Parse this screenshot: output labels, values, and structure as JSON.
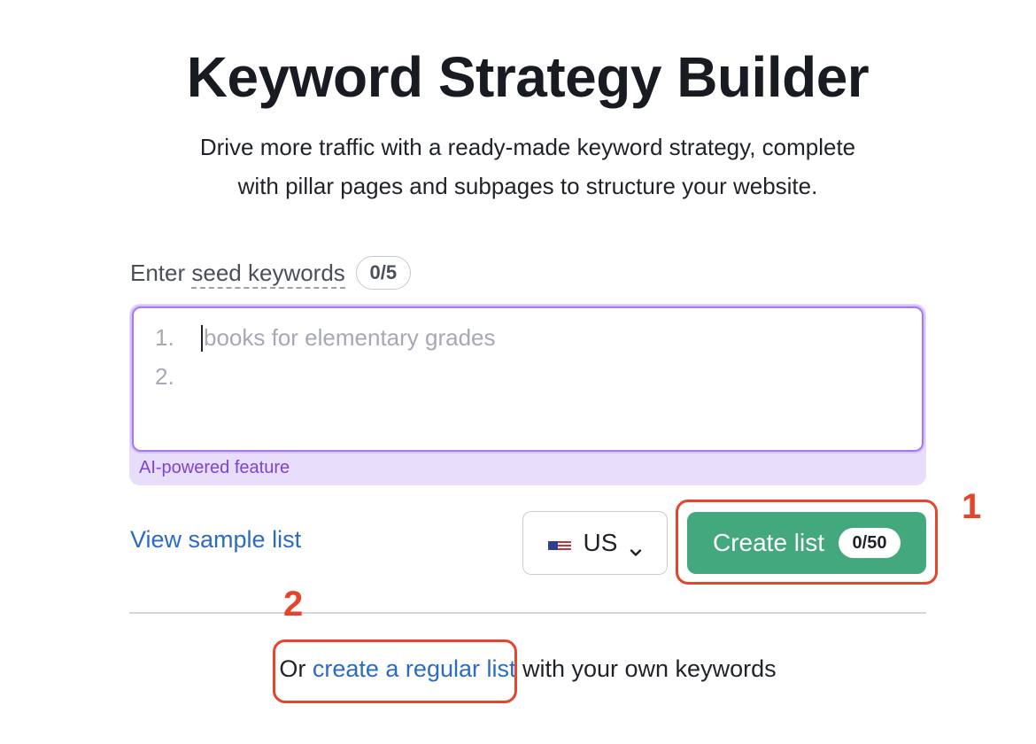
{
  "header": {
    "title": "Keyword Strategy Builder",
    "subtitle_line1": "Drive more traffic with a ready-made keyword strategy, complete",
    "subtitle_line2": "with pillar pages and subpages to structure your website."
  },
  "seed": {
    "label_prefix": "Enter ",
    "label_term": "seed keywords",
    "counter": "0/5",
    "lines": [
      {
        "number": "1.",
        "placeholder": "books for elementary grades"
      },
      {
        "number": "2.",
        "placeholder": ""
      }
    ],
    "ai_label": "AI-powered feature"
  },
  "actions": {
    "view_sample": "View sample list",
    "country": "US",
    "country_flag_icon": "us-flag-icon",
    "create_label": "Create list",
    "create_count": "0/50"
  },
  "footer": {
    "prefix": "Or ",
    "link": "create a regular list",
    "suffix": " with your own keywords"
  },
  "annotations": [
    {
      "number": "1",
      "color": "#e5452d"
    },
    {
      "number": "2",
      "color": "#e5452d"
    }
  ],
  "colors": {
    "accent_green": "#44a87f",
    "link_blue": "#2b6bc4",
    "ai_purple": "#7a44d4",
    "annotation_red": "#e5452d"
  }
}
